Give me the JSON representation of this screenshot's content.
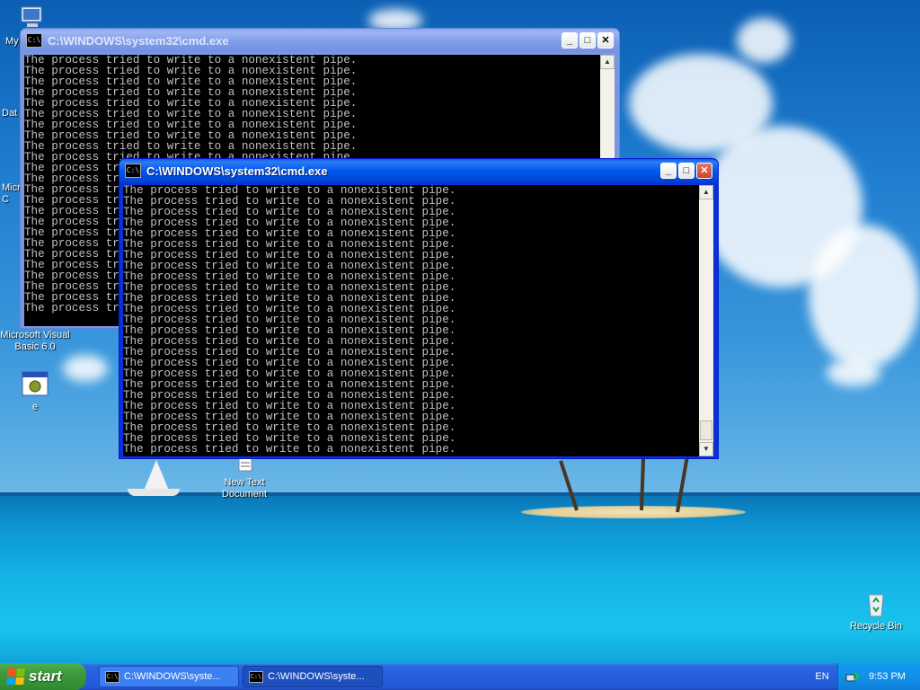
{
  "desktop": {
    "icons": [
      {
        "label": "My"
      },
      {
        "label": "Dat"
      },
      {
        "label": "Micro C"
      },
      {
        "label": "Microsoft Visual Basic 6.0"
      },
      {
        "label": "e"
      },
      {
        "label": "New Text Document"
      },
      {
        "label": "Recycle Bin"
      }
    ]
  },
  "windows": [
    {
      "title": "C:\\WINDOWS\\system32\\cmd.exe",
      "state": "inactive",
      "lines": [
        "The process tried to write to a nonexistent pipe.",
        "The process tried to write to a nonexistent pipe.",
        "The process tried to write to a nonexistent pipe.",
        "The process tried to write to a nonexistent pipe.",
        "The process tried to write to a nonexistent pipe.",
        "The process tried to write to a nonexistent pipe.",
        "The process tried to write to a nonexistent pipe.",
        "The process tried to write to a nonexistent pipe.",
        "The process tried to write to a nonexistent pipe.",
        "The process tried to write to a nonexistent pipe.",
        "The process tried to write to a nonexistent pipe.",
        "The process tried to write to a nonexistent pipe.",
        "The process tried to write to a nonexistent pipe.",
        "The process tried to write to a nonexistent pipe.",
        "The process tried to write to a nonexistent pipe.",
        "The process tried to write to a nonexistent pipe.",
        "The process tried to write to a nonexistent pipe.",
        "The process tried to write to a nonexistent pipe.",
        "The process tried to write to a nonexistent pipe.",
        "The process tried to write to a nonexistent pipe.",
        "The process tried to write to a nonexistent pipe.",
        "The process tried to write to a nonexistent pipe.",
        "The process tried to write to a nonexistent pipe.",
        "The process tried to write to a nonexistent pipe."
      ]
    },
    {
      "title": "C:\\WINDOWS\\system32\\cmd.exe",
      "state": "active",
      "lines": [
        "The process tried to write to a nonexistent pipe.",
        "The process tried to write to a nonexistent pipe.",
        "The process tried to write to a nonexistent pipe.",
        "The process tried to write to a nonexistent pipe.",
        "The process tried to write to a nonexistent pipe.",
        "The process tried to write to a nonexistent pipe.",
        "The process tried to write to a nonexistent pipe.",
        "The process tried to write to a nonexistent pipe.",
        "The process tried to write to a nonexistent pipe.",
        "The process tried to write to a nonexistent pipe.",
        "The process tried to write to a nonexistent pipe.",
        "The process tried to write to a nonexistent pipe.",
        "The process tried to write to a nonexistent pipe.",
        "The process tried to write to a nonexistent pipe.",
        "The process tried to write to a nonexistent pipe.",
        "The process tried to write to a nonexistent pipe.",
        "The process tried to write to a nonexistent pipe.",
        "The process tried to write to a nonexistent pipe.",
        "The process tried to write to a nonexistent pipe.",
        "The process tried to write to a nonexistent pipe.",
        "The process tried to write to a nonexistent pipe.",
        "The process tried to write to a nonexistent pipe.",
        "The process tried to write to a nonexistent pipe.",
        "The process tried to write to a nonexistent pipe.",
        "The process tried to write to a nonexistent pipe."
      ]
    }
  ],
  "taskbar": {
    "start_label": "start",
    "tasks": [
      {
        "label": "C:\\WINDOWS\\syste..."
      },
      {
        "label": "C:\\WINDOWS\\syste..."
      }
    ],
    "language": "EN",
    "clock": "9:53 PM"
  },
  "colors": {
    "titlebar_active": "#0058ee",
    "titlebar_inactive": "#7e9be6",
    "console_bg": "#000000",
    "console_text": "#c0c0c0",
    "start_green": "#3c9a3c",
    "tray_blue": "#1290e8"
  }
}
